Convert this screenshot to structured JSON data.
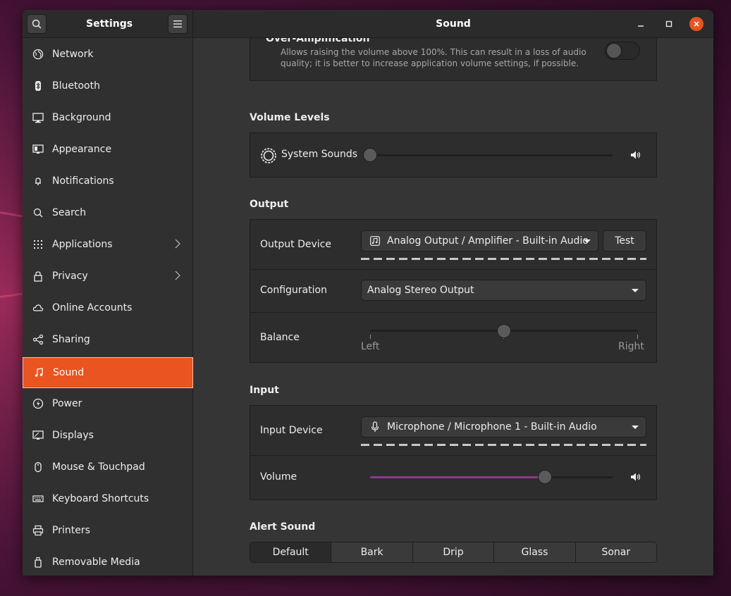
{
  "window": {
    "sidebar_title": "Settings",
    "panel_title": "Sound"
  },
  "sidebar": {
    "items": [
      {
        "label": "Network",
        "icon": "network-icon"
      },
      {
        "label": "Bluetooth",
        "icon": "bluetooth-icon"
      },
      {
        "label": "Background",
        "icon": "background-icon"
      },
      {
        "label": "Appearance",
        "icon": "appearance-icon"
      },
      {
        "label": "Notifications",
        "icon": "bell-icon"
      },
      {
        "label": "Search",
        "icon": "search-icon"
      },
      {
        "label": "Applications",
        "icon": "grid-icon"
      },
      {
        "label": "Privacy",
        "icon": "lock-icon"
      },
      {
        "label": "Online Accounts",
        "icon": "cloud-icon"
      },
      {
        "label": "Sharing",
        "icon": "share-icon"
      },
      {
        "label": "Sound",
        "icon": "music-note-icon"
      },
      {
        "label": "Power",
        "icon": "power-icon"
      },
      {
        "label": "Displays",
        "icon": "display-icon"
      },
      {
        "label": "Mouse & Touchpad",
        "icon": "mouse-icon"
      },
      {
        "label": "Keyboard Shortcuts",
        "icon": "keyboard-icon"
      },
      {
        "label": "Printers",
        "icon": "printer-icon"
      },
      {
        "label": "Removable Media",
        "icon": "removable-media-icon"
      }
    ],
    "active": "Sound"
  },
  "over_amplification": {
    "title": "Over-Amplification",
    "description_line1": "Allows raising the volume above 100%. This can result in a loss of audio",
    "description_line2": "quality; it is better to increase application volume settings, if possible.",
    "enabled": false
  },
  "volume_levels": {
    "heading": "Volume Levels",
    "system_sounds_label": "System Sounds",
    "system_sounds_level": 0
  },
  "output": {
    "heading": "Output",
    "device_label": "Output Device",
    "device_value": "Analog Output / Amplifier - Built-in Audio",
    "test_button": "Test",
    "configuration_label": "Configuration",
    "configuration_value": "Analog Stereo Output",
    "balance_label": "Balance",
    "balance_left": "Left",
    "balance_right": "Right",
    "balance_level": 0.5
  },
  "input": {
    "heading": "Input",
    "device_label": "Input Device",
    "device_value": "Microphone / Microphone 1 - Built-in Audio",
    "volume_label": "Volume",
    "volume_level": 0.72
  },
  "alert_sound": {
    "heading": "Alert Sound",
    "options": [
      "Default",
      "Bark",
      "Drip",
      "Glass",
      "Sonar"
    ],
    "selected": "Default"
  },
  "colors": {
    "accent": "#e95420",
    "volume_fill": "#8b3a8b"
  }
}
